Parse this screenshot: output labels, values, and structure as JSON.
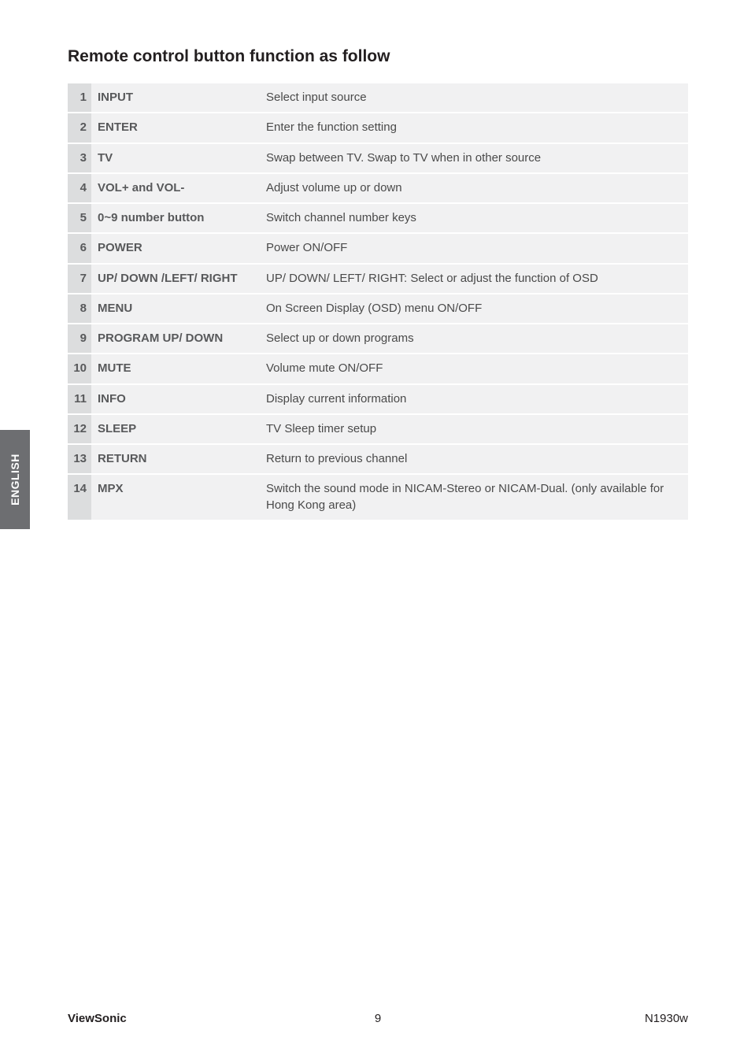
{
  "sideTab": "ENGLISH",
  "title": "Remote control button function as follow",
  "rows": [
    {
      "num": "1",
      "name": "INPUT",
      "desc": "Select input source"
    },
    {
      "num": "2",
      "name": "ENTER",
      "desc": "Enter the function setting"
    },
    {
      "num": "3",
      "name": "TV",
      "desc": "Swap between TV. Swap to TV when in other source"
    },
    {
      "num": "4",
      "name": "VOL+ and VOL-",
      "desc": "Adjust volume up or down"
    },
    {
      "num": "5",
      "name": "0~9 number button",
      "desc": "Switch channel number keys"
    },
    {
      "num": "6",
      "name": "POWER",
      "desc": "Power ON/OFF"
    },
    {
      "num": "7",
      "name": "UP/ DOWN /LEFT/ RIGHT",
      "desc": "UP/ DOWN/ LEFT/ RIGHT: Select or adjust the function of OSD"
    },
    {
      "num": "8",
      "name": "MENU",
      "desc": "On Screen Display (OSD) menu ON/OFF"
    },
    {
      "num": "9",
      "name": "PROGRAM UP/ DOWN",
      "desc": "Select up or down programs"
    },
    {
      "num": "10",
      "name": "MUTE",
      "desc": "Volume mute ON/OFF"
    },
    {
      "num": "11",
      "name": "INFO",
      "desc": "Display current information"
    },
    {
      "num": "12",
      "name": "SLEEP",
      "desc": "TV Sleep timer setup"
    },
    {
      "num": "13",
      "name": "RETURN",
      "desc": "Return to previous channel"
    },
    {
      "num": "14",
      "name": "MPX",
      "desc": "Switch the sound mode in NICAM-Stereo or NICAM-Dual. (only available for Hong Kong area)"
    }
  ],
  "footer": {
    "brand": "ViewSonic",
    "page": "9",
    "model": "N1930w"
  }
}
